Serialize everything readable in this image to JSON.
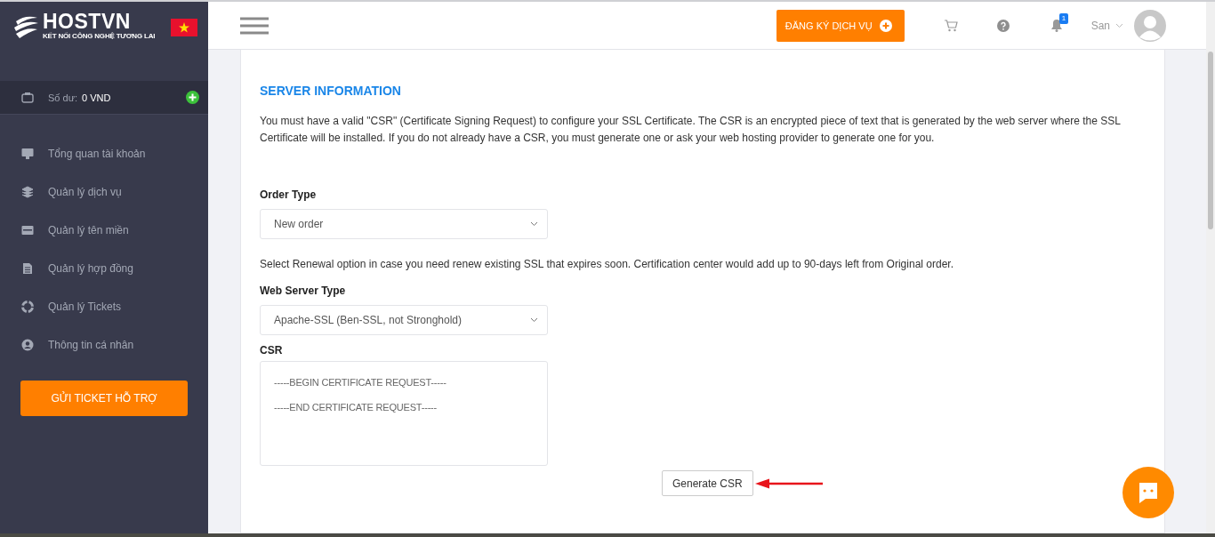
{
  "sidebar": {
    "logo": {
      "name": "HOSTVN",
      "tagline": "KẾT NỐI CÔNG NGHỆ TƯƠNG LAI"
    },
    "balance": {
      "label": "Số dư:",
      "value": "0 VND"
    },
    "items": [
      {
        "label": "Tổng quan tài khoản"
      },
      {
        "label": "Quản lý dịch vụ"
      },
      {
        "label": "Quản lý tên miền"
      },
      {
        "label": "Quản lý hợp đồng"
      },
      {
        "label": "Quản lý Tickets"
      },
      {
        "label": "Thông tin cá nhân"
      }
    ],
    "support_button": "GỬI TICKET HỖ TRỢ"
  },
  "header": {
    "register_button": "ĐĂNG KÝ DỊCH VỤ",
    "notification_count": "1",
    "user": "San"
  },
  "section": {
    "title": "SERVER INFORMATION",
    "intro": "You must have a valid \"CSR\" (Certificate Signing Request) to configure your SSL Certificate. The CSR is an encrypted piece of text that is generated by the web server where the SSL Certificate will be installed. If you do not already have a CSR, you must generate one or ask your web hosting provider to generate one for you.",
    "fields": [
      {
        "kind": "select",
        "label": "Order Type",
        "value": "New order",
        "help": "Select Renewal option in case you need renew existing SSL that expires soon. Certification center would add up to 90-days left from Original order."
      },
      {
        "kind": "select",
        "label": "Web Server Type",
        "value": "Apache-SSL (Ben-SSL, not Stronghold)"
      },
      {
        "kind": "textarea",
        "label": "CSR",
        "value": "-----BEGIN CERTIFICATE REQUEST-----\n-----END CERTIFICATE REQUEST-----"
      }
    ],
    "button": "Generate CSR"
  }
}
